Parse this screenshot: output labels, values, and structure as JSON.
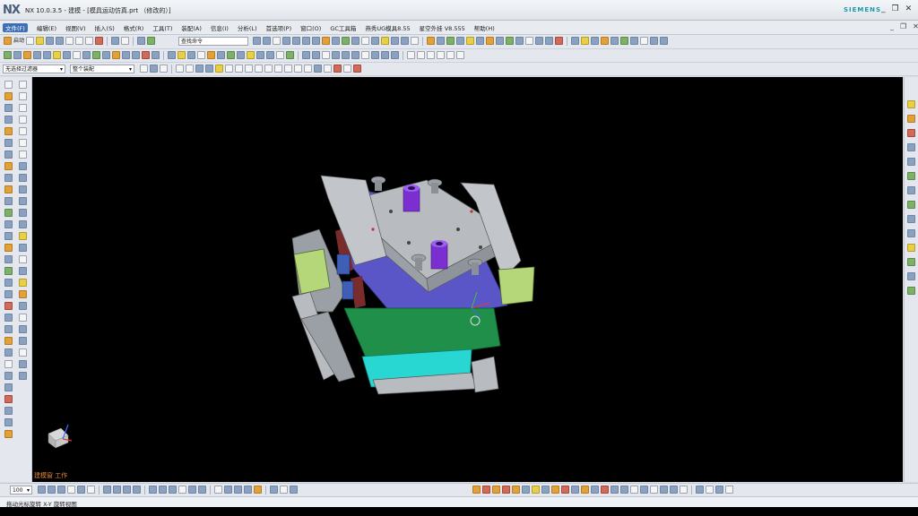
{
  "window": {
    "logo": "NX",
    "title": "NX 10.0.3.5 - 建模 - [模具运动仿真.prt （修改的）]",
    "brand": "SIEMENS",
    "controls": [
      "_",
      "❐",
      "✕"
    ]
  },
  "menu": {
    "items": [
      "文件(F)",
      "编辑(E)",
      "视图(V)",
      "插入(S)",
      "格式(R)",
      "工具(T)",
      "装配(A)",
      "信息(I)",
      "分析(L)",
      "首选项(P)",
      "窗口(O)",
      "GC工具箱",
      "燕秀UG模具8.55",
      "星空外挂 V8.555",
      "帮助(H)"
    ],
    "right": [
      "_",
      "❐",
      "✕"
    ]
  },
  "toolbar": {
    "start_label": "启动",
    "command_search_placeholder": "查找命令",
    "selection_filter": "无选择过滤器",
    "assembly_scope": "整个装配"
  },
  "viewport": {
    "mode_label": "建模窗 工作",
    "background": "#000000"
  },
  "bottom_toolbar": {
    "zoom": "100"
  },
  "status": {
    "text": "拖动光标旋转 X-Y 旋转视图"
  },
  "colors": {
    "plate_gray": "#b8bcc0",
    "plate_blue": "#5a56c8",
    "plate_green": "#1f8f4a",
    "plate_cyan": "#28d6d2",
    "guide_purple": "#7b2fd1",
    "slider_green": "#b6d67a"
  },
  "icons": {
    "left": [
      "sketch-icon",
      "line-icon",
      "arc-icon",
      "rectangle-icon",
      "circle-icon",
      "extrude-icon",
      "revolve-icon",
      "hole-icon",
      "boss-icon",
      "pocket-icon",
      "blend-icon",
      "chamfer-icon",
      "shell-icon",
      "draft-icon",
      "trim-icon",
      "mirror-icon",
      "pattern-icon",
      "unite-icon",
      "subtract-icon",
      "intersect-icon",
      "text-icon",
      "measure-icon",
      "section-icon",
      "layer-icon"
    ],
    "right": [
      "assembly-navigator-icon",
      "part-navigator-icon",
      "reuse-library-icon",
      "history-icon",
      "web-browser-icon",
      "roles-icon",
      "system-materials-icon",
      "mold-wizard-icon",
      "motion-icon"
    ]
  }
}
